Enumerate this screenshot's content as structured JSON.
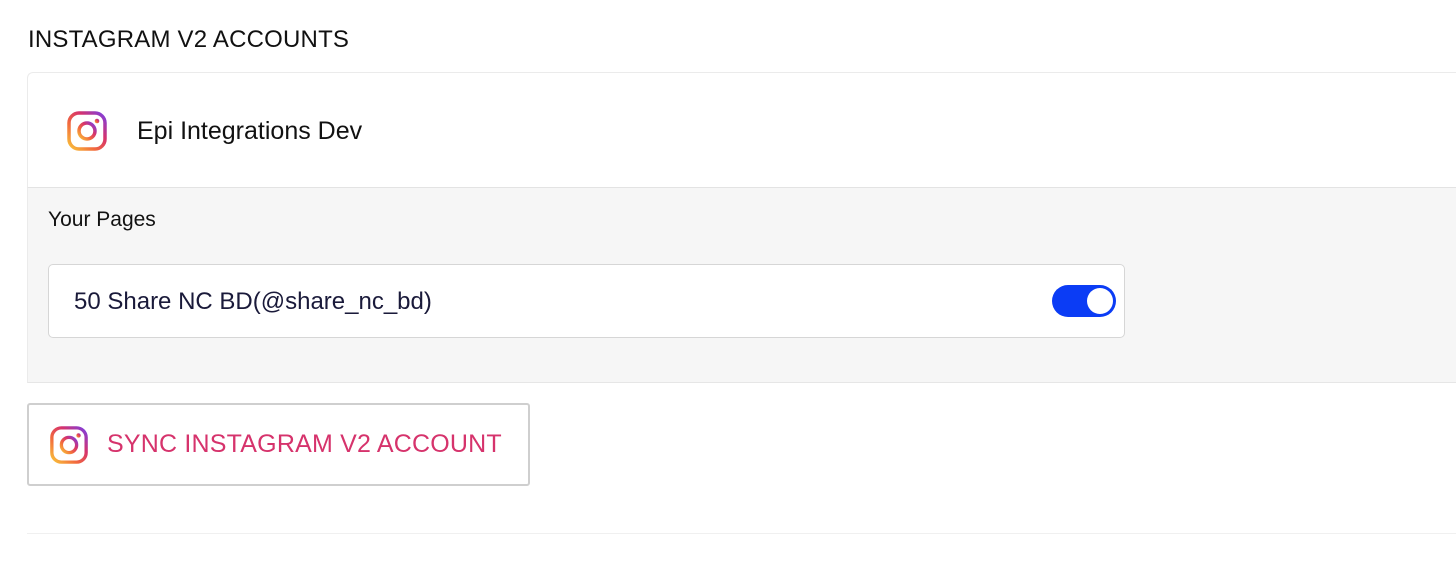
{
  "section": {
    "title": "INSTAGRAM V2 ACCOUNTS"
  },
  "account": {
    "name": "Epi Integrations Dev",
    "icon": "instagram-icon"
  },
  "pages": {
    "label": "Your Pages",
    "items": [
      {
        "name": "50 Share NC BD(@share_nc_bd)",
        "enabled": true
      }
    ]
  },
  "sync_button": {
    "label": "SYNC INSTAGRAM V2 ACCOUNT",
    "icon": "instagram-icon"
  },
  "colors": {
    "accent": "#0b3cf5",
    "sync_text": "#d6336c",
    "instagram_gradient": [
      "#f9c33a",
      "#f26a3d",
      "#d6336c",
      "#7b3fe4"
    ]
  }
}
